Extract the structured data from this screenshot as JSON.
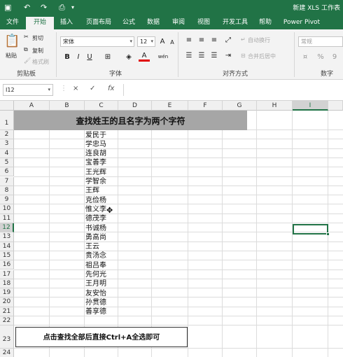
{
  "titlebar": {
    "save_icon": "save-icon",
    "undo_icon": "undo-icon",
    "redo_icon": "redo-icon",
    "doc_title": "新建 XLS 工作表"
  },
  "tabs": [
    "文件",
    "开始",
    "插入",
    "页面布局",
    "公式",
    "数据",
    "审阅",
    "视图",
    "开发工具",
    "帮助",
    "Power Pivot"
  ],
  "active_tab": "开始",
  "ribbon": {
    "clipboard": {
      "paste": "粘贴",
      "cut": "剪切",
      "copy": "复制",
      "format_painter": "格式刷",
      "label": "剪贴板"
    },
    "font": {
      "font_name": "宋体",
      "font_size": "12",
      "bold": "B",
      "italic": "I",
      "underline": "U",
      "grow": "A",
      "shrink": "A",
      "font_color": "A",
      "phonetic": "wén",
      "label": "字体"
    },
    "alignment": {
      "wrap": "自动换行",
      "merge": "合并后居中",
      "label": "对齐方式"
    },
    "number": {
      "format": "常规",
      "percent": "%",
      "comma": "9",
      "label": "数字"
    }
  },
  "formula_bar": {
    "name_box": "I12",
    "cancel": "×",
    "enter": "✓",
    "fx": "fx",
    "value": ""
  },
  "columns": [
    "A",
    "B",
    "C",
    "D",
    "E",
    "F",
    "G",
    "H",
    "I"
  ],
  "selected_column": "I",
  "rows": [
    "1",
    "2",
    "3",
    "4",
    "5",
    "6",
    "7",
    "8",
    "9",
    "10",
    "11",
    "12",
    "13",
    "14",
    "15",
    "16",
    "17",
    "18",
    "19",
    "20",
    "21",
    "22",
    "23",
    "24"
  ],
  "selected_row": "12",
  "sheet": {
    "title": "查找姓王的且名字为两个字符",
    "names": [
      "爱民于",
      "学忠马",
      "连良胡",
      "宝善李",
      "王光辉",
      "学智余",
      "王辉",
      "克俭杨",
      "惟义李",
      "德茂李",
      "书诚杨",
      "勇高尚",
      "王云",
      "贵汤念",
      "祖吕奉",
      "先何光",
      "王月明",
      "友安怡",
      "孙贯德",
      "善享德"
    ],
    "note": "点击查找全部后直接Ctrl+A全选即可"
  },
  "colors": {
    "accent": "#217346",
    "title_fill": "#a6a6a6"
  }
}
